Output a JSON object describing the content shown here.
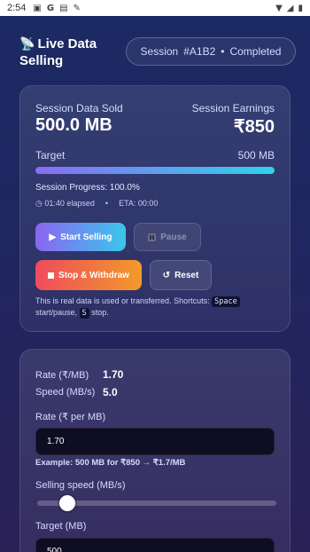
{
  "status_bar": {
    "time": "2:54",
    "icons": [
      "image-icon",
      "google-icon",
      "lock-icon",
      "wrench-icon"
    ],
    "right_icons": [
      "wifi-icon",
      "signal-icon",
      "battery-icon"
    ]
  },
  "header": {
    "title": "Live Data Selling",
    "session_label": "Session",
    "session_id": "#A1B2",
    "separator": "•",
    "session_status": "Completed"
  },
  "summary": {
    "sold_label": "Session Data Sold",
    "sold_value": "500.0 MB",
    "earnings_label": "Session Earnings",
    "earnings_value": "₹850",
    "target_label": "Target",
    "target_value": "500 MB",
    "progress_fraction": 1.0,
    "progress_text": "Session Progress: 100.0%",
    "elapsed": "01:40 elapsed",
    "dot": "•",
    "eta": "ETA: 00:00"
  },
  "controls": {
    "start_label": "Start Selling",
    "pause_label": "Pause",
    "stop_label": "Stop & Withdraw",
    "reset_label": "Reset",
    "notice_pre": "This is real data is used or transferred. Shortcuts:",
    "kbd_space": "Space",
    "notice_mid": "start/pause,",
    "kbd_s": "S",
    "notice_post": "stop."
  },
  "settings": {
    "rate_label": "Rate (₹/MB)",
    "rate_value": "1.70",
    "speed_label": "Speed (MB/s)",
    "speed_value": "5.0",
    "rate_field_label": "Rate (₹ per MB)",
    "rate_field_value": "1.70",
    "example": "Example: 500 MB for ₹850 → ₹1.7/MB",
    "speed_field_label": "Selling speed (MB/s)",
    "speed_slider_fraction": 0.1,
    "target_field_label": "Target (MB)",
    "target_field_value": "500"
  },
  "colors": {
    "accent_start": "#8b66f1",
    "accent_end": "#3cc6ea",
    "stop_start": "#ef4b5c",
    "stop_end": "#f29a2a"
  }
}
